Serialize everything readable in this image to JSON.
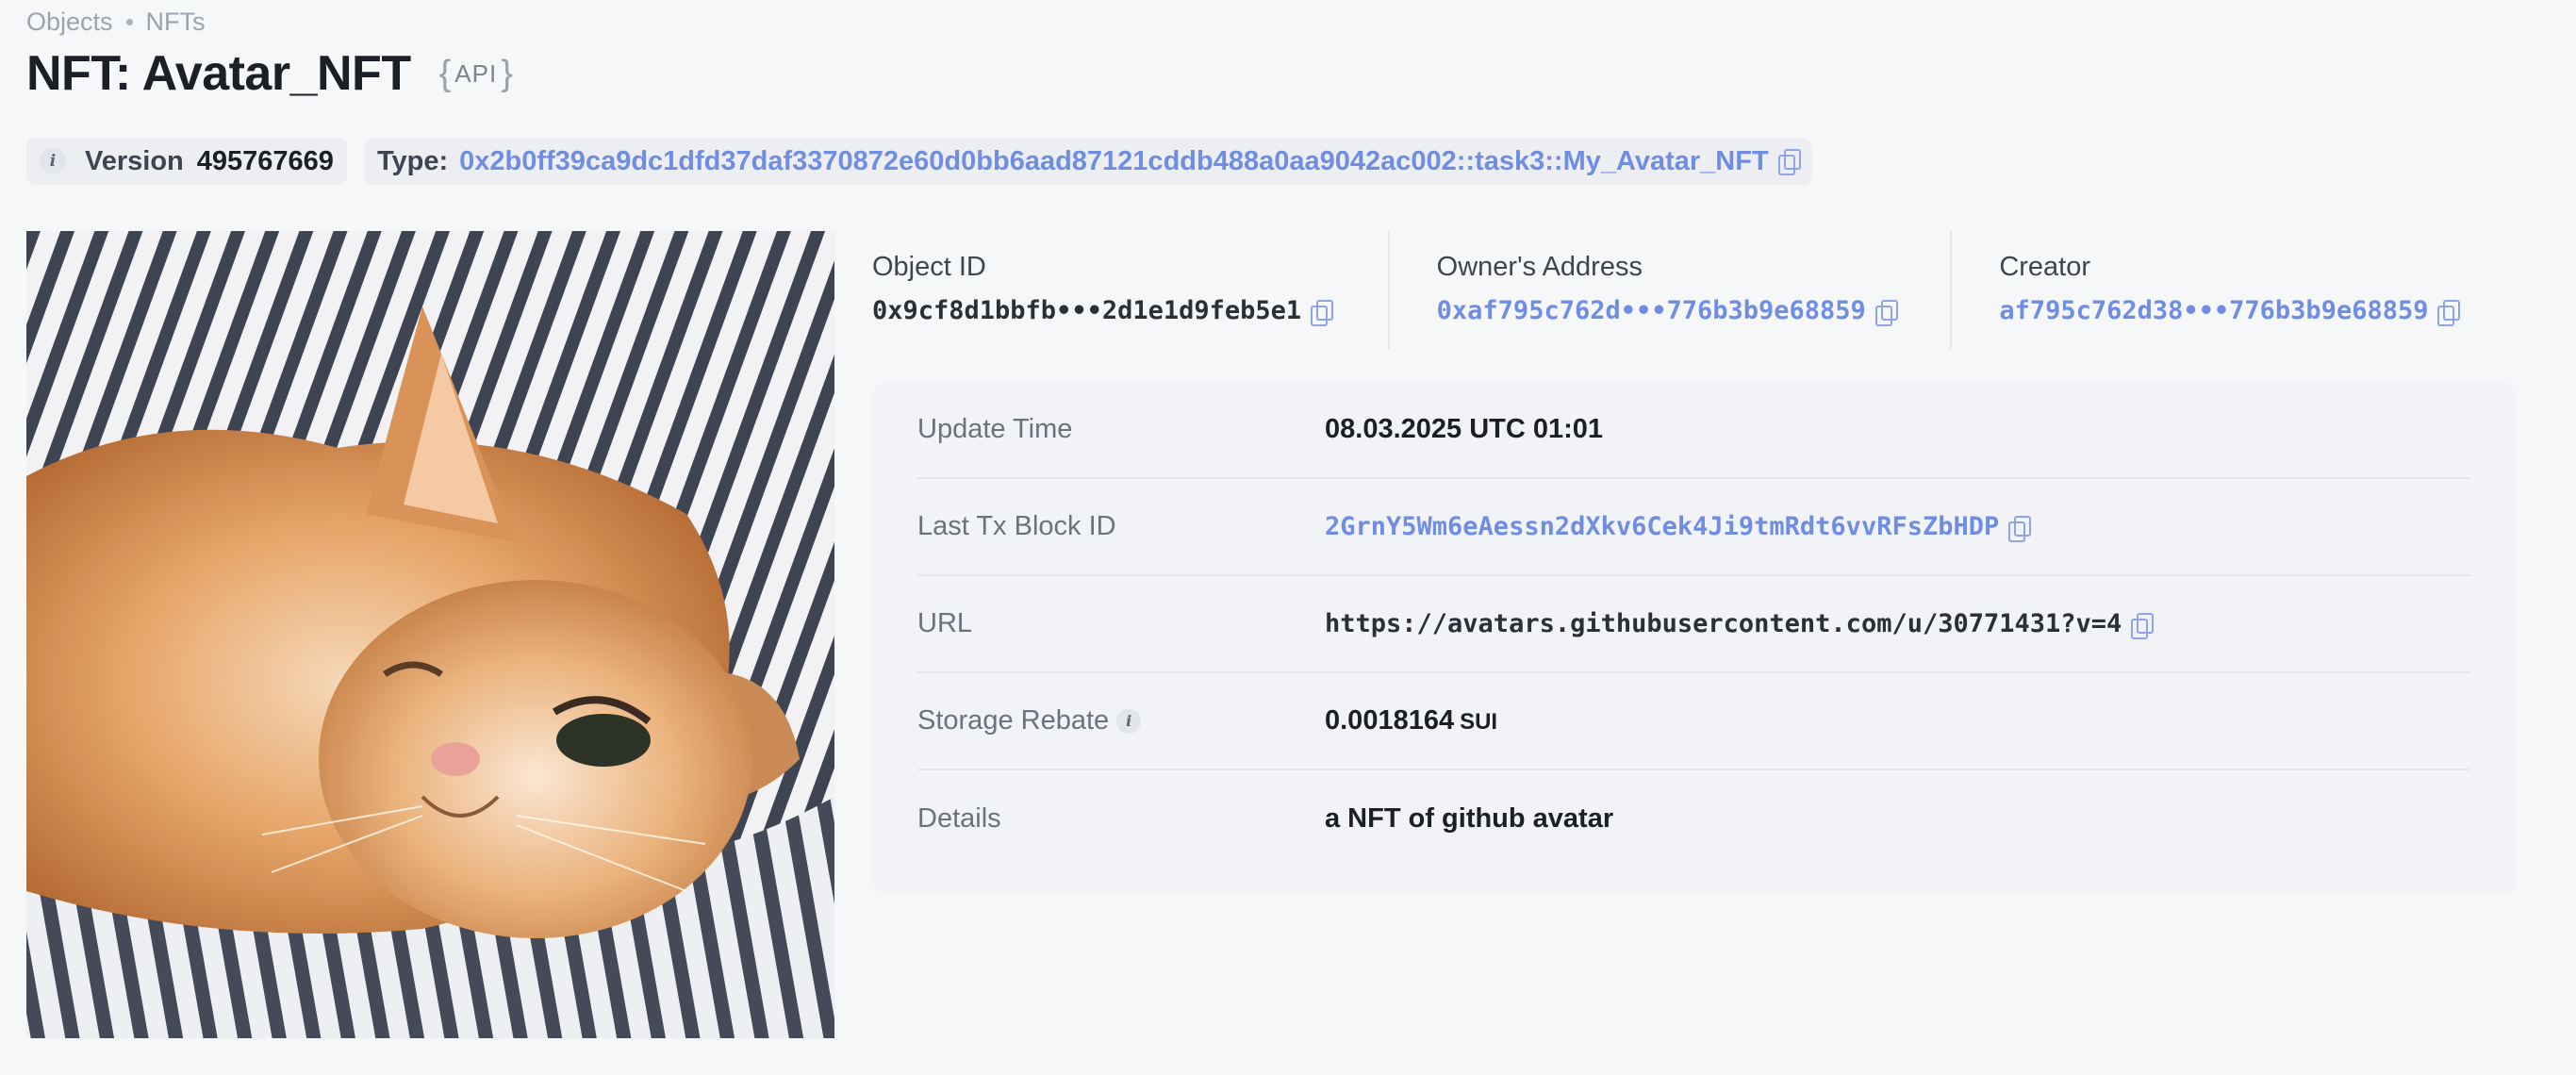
{
  "breadcrumb": [
    "Objects",
    "NFTs"
  ],
  "title": "NFT: Avatar_NFT",
  "api_badge": "API",
  "version": {
    "label": "Version",
    "value": "495767669"
  },
  "type": {
    "label": "Type:",
    "value": "0x2b0ff39ca9dc1dfd37daf3370872e60d0bb6aad87121cddb488a0aa9042ac002::task3::My_Avatar_NFT"
  },
  "ids": {
    "object_id": {
      "label": "Object ID",
      "value": "0x9cf8d1bbfb•••2d1e1d9feb5e1"
    },
    "owner": {
      "label": "Owner's Address",
      "value": "0xaf795c762d•••776b3b9e68859"
    },
    "creator": {
      "label": "Creator",
      "value": "af795c762d38•••776b3b9e68859"
    }
  },
  "details": {
    "update_time": {
      "label": "Update Time",
      "value": "08.03.2025 UTC 01:01"
    },
    "last_tx": {
      "label": "Last Tx Block ID",
      "value": "2GrnY5Wm6eAessn2dXkv6Cek4Ji9tmRdt6vvRFsZbHDP"
    },
    "url": {
      "label": "URL",
      "value": "https://avatars.githubusercontent.com/u/30771431?v=4"
    },
    "storage_rebate": {
      "label": "Storage Rebate",
      "value": "0.0018164",
      "unit": "SUI"
    },
    "details": {
      "label": "Details",
      "value": "a NFT of github avatar"
    }
  },
  "icons": {
    "info": "info-icon",
    "copy": "copy-icon"
  },
  "colors": {
    "link": "#6f8de3",
    "background": "#f6f7f9"
  }
}
